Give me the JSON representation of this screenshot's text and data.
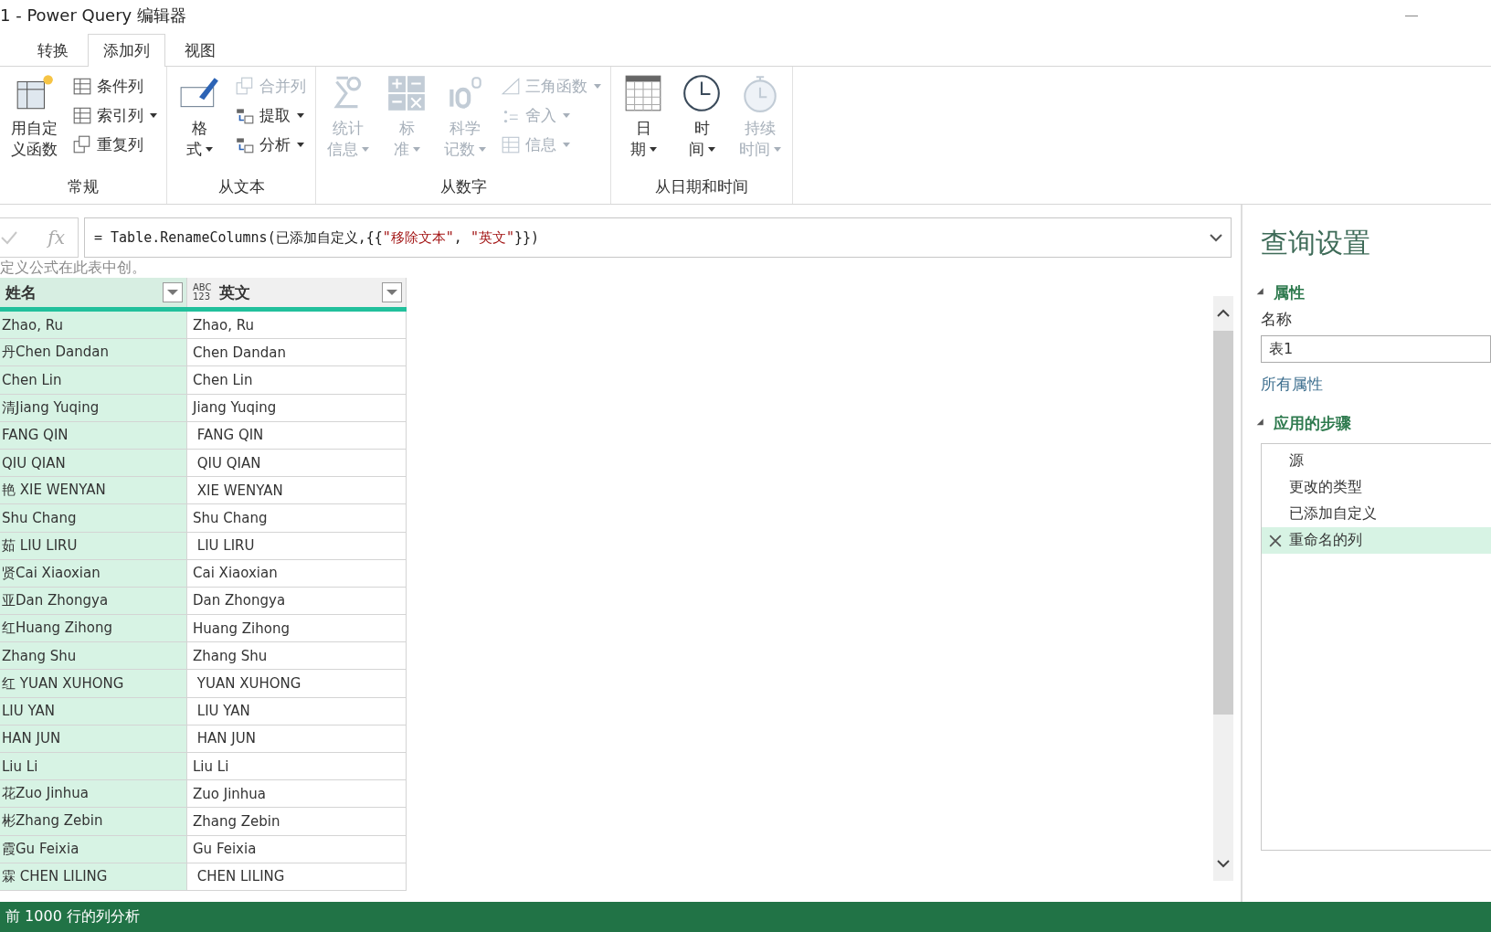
{
  "window": {
    "title": "1 - Power Query 编辑器"
  },
  "tabs": [
    {
      "label": "转换",
      "selected": false
    },
    {
      "label": "添加列",
      "selected": true
    },
    {
      "label": "视图",
      "selected": false
    }
  ],
  "ribbon": {
    "groups": [
      {
        "label": "常规",
        "columns": [
          {
            "kind": "large",
            "lines": [
              "用自定",
              "义函数"
            ],
            "disabled": false,
            "dropdown": false
          },
          {
            "kind": "stack",
            "items": [
              {
                "label": "条件列",
                "disabled": false,
                "dropdown": false
              },
              {
                "label": "索引列",
                "disabled": false,
                "dropdown": true
              },
              {
                "label": "重复列",
                "disabled": false,
                "dropdown": false
              }
            ]
          }
        ]
      },
      {
        "label": "从文本",
        "columns": [
          {
            "kind": "large",
            "lines": [
              "格",
              "式"
            ],
            "disabled": false,
            "dropdown": true
          },
          {
            "kind": "stack",
            "items": [
              {
                "label": "合并列",
                "disabled": true,
                "dropdown": false
              },
              {
                "label": "提取",
                "disabled": false,
                "dropdown": true
              },
              {
                "label": "分析",
                "disabled": false,
                "dropdown": true
              }
            ]
          }
        ]
      },
      {
        "label": "从数字",
        "columns": [
          {
            "kind": "large",
            "lines": [
              "统计",
              "信息"
            ],
            "disabled": true,
            "dropdown": true
          },
          {
            "kind": "large",
            "lines": [
              "标",
              "准"
            ],
            "disabled": true,
            "dropdown": true
          },
          {
            "kind": "large",
            "lines": [
              "科学",
              "记数"
            ],
            "disabled": true,
            "dropdown": true
          },
          {
            "kind": "stack",
            "items": [
              {
                "label": "三角函数",
                "disabled": true,
                "dropdown": true
              },
              {
                "label": "舍入",
                "disabled": true,
                "dropdown": true
              },
              {
                "label": "信息",
                "disabled": true,
                "dropdown": true
              }
            ]
          }
        ]
      },
      {
        "label": "从日期和时间",
        "columns": [
          {
            "kind": "large",
            "lines": [
              "日",
              "期"
            ],
            "disabled": false,
            "dropdown": true
          },
          {
            "kind": "large",
            "lines": [
              "时",
              "间"
            ],
            "disabled": false,
            "dropdown": true
          },
          {
            "kind": "large",
            "lines": [
              "持续",
              "时间"
            ],
            "disabled": true,
            "dropdown": true
          }
        ]
      }
    ]
  },
  "formula_bar": {
    "fx_label": "fx",
    "formula": [
      {
        "text": "= Table.RenameColumns(已添加自定义,{{",
        "kind": "code"
      },
      {
        "text": "\"移除文本\"",
        "kind": "string"
      },
      {
        "text": ", ",
        "kind": "code"
      },
      {
        "text": "\"英文\"",
        "kind": "string"
      },
      {
        "text": "}})",
        "kind": "code"
      }
    ]
  },
  "tooltip": {
    "lines": [
      "定义公式在此表中创",
      "。"
    ]
  },
  "table": {
    "columns": [
      {
        "name": "姓名",
        "selected": true
      },
      {
        "name": "英文",
        "selected": false,
        "type_icon": [
          "ABC",
          "123"
        ]
      }
    ],
    "rows": [
      [
        "Zhao, Ru",
        "Zhao, Ru"
      ],
      [
        "丹Chen Dandan",
        "Chen Dandan"
      ],
      [
        "Chen Lin",
        "Chen Lin"
      ],
      [
        "清Jiang Yuqing",
        "Jiang Yuqing"
      ],
      [
        "FANG QIN",
        " FANG QIN"
      ],
      [
        "QIU QIAN",
        " QIU QIAN"
      ],
      [
        "艳 XIE WENYAN",
        " XIE WENYAN"
      ],
      [
        "Shu Chang",
        "Shu Chang"
      ],
      [
        "茹 LIU LIRU",
        " LIU LIRU"
      ],
      [
        "贤Cai Xiaoxian",
        "Cai Xiaoxian"
      ],
      [
        "亚Dan Zhongya",
        "Dan Zhongya"
      ],
      [
        "红Huang Zihong",
        "Huang Zihong"
      ],
      [
        "Zhang Shu",
        "Zhang Shu"
      ],
      [
        "红 YUAN XUHONG",
        " YUAN XUHONG"
      ],
      [
        "LIU YAN",
        " LIU YAN"
      ],
      [
        "HAN JUN",
        " HAN JUN"
      ],
      [
        "Liu Li",
        "Liu Li"
      ],
      [
        "花Zuo Jinhua",
        "Zuo Jinhua"
      ],
      [
        "彬Zhang Zebin",
        "Zhang Zebin"
      ],
      [
        "霞Gu Feixia",
        "Gu Feixia"
      ],
      [
        "霖 CHEN LILING",
        " CHEN LILING"
      ]
    ]
  },
  "query_settings": {
    "title": "查询设置",
    "sections": [
      {
        "kind": "properties",
        "title": "属性",
        "expanded": true,
        "name_label": "名称",
        "name_value": "表1",
        "link": "所有属性"
      },
      {
        "kind": "steps",
        "title": "应用的步骤",
        "expanded": true,
        "steps": [
          {
            "label": "源",
            "selected": false
          },
          {
            "label": "更改的类型",
            "selected": false
          },
          {
            "label": "已添加自定义",
            "selected": false
          },
          {
            "label": "重命名的列",
            "selected": true
          }
        ]
      }
    ]
  },
  "status_bar": {
    "text": "前 1000 行的列分析"
  }
}
